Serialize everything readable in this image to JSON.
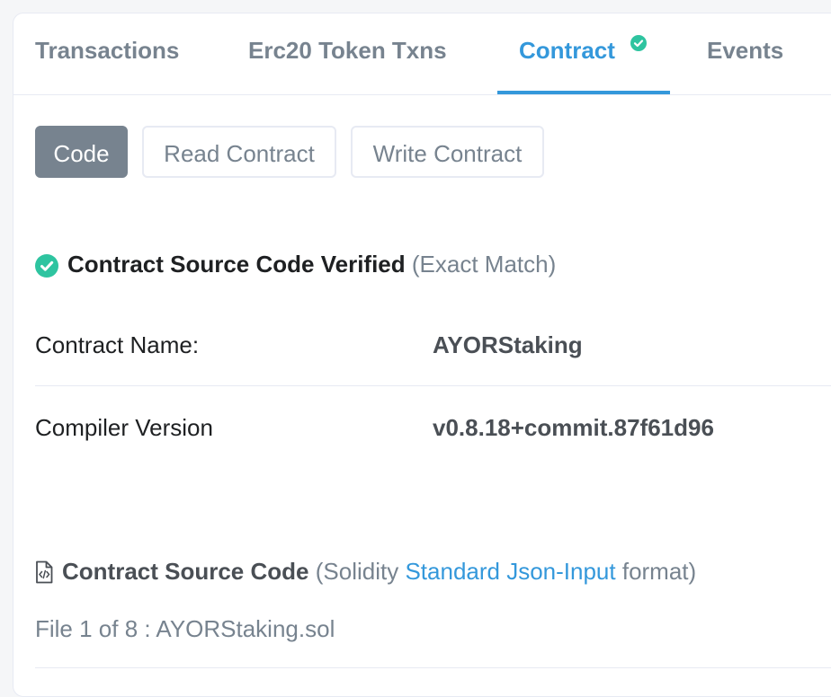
{
  "tabs": [
    {
      "label": "Transactions"
    },
    {
      "label": "Erc20 Token Txns"
    },
    {
      "label": "Contract"
    },
    {
      "label": "Events"
    }
  ],
  "subtabs": {
    "code": "Code",
    "read": "Read Contract",
    "write": "Write Contract"
  },
  "verified": {
    "title": "Contract Source Code Verified",
    "match": "(Exact Match)"
  },
  "info": {
    "name_label": "Contract Name:",
    "name_value": "AYORStaking",
    "compiler_label": "Compiler Version",
    "compiler_value": "v0.8.18+commit.87f61d96"
  },
  "source": {
    "title": "Contract Source Code",
    "pre": "(Solidity",
    "link": "Standard Json-Input",
    "post": "format)",
    "file": "File 1 of 8 : AYORStaking.sol"
  },
  "colors": {
    "accent": "#3498db",
    "success": "#2ec4a0",
    "muted": "#77838f"
  },
  "icons": [
    "check-circle-icon",
    "file-code-icon"
  ]
}
